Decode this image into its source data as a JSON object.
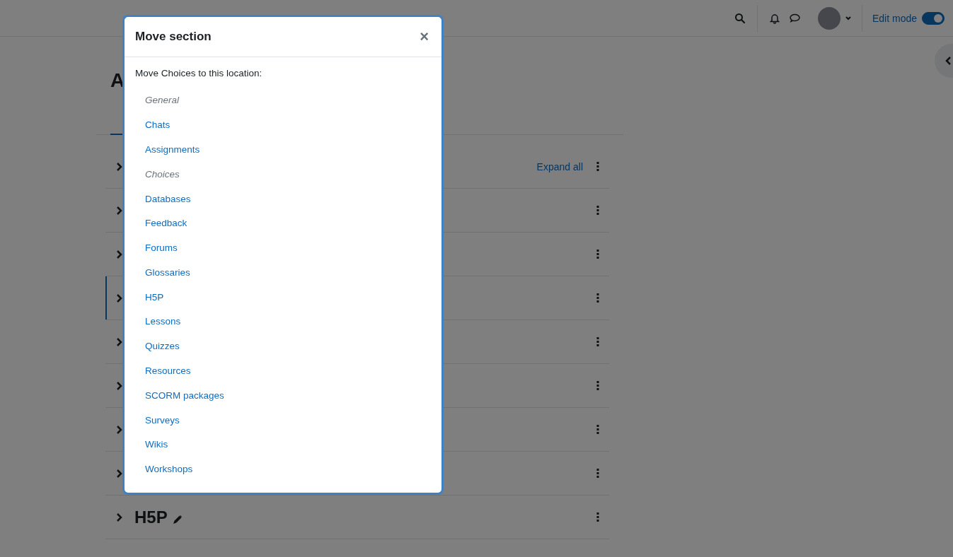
{
  "header": {
    "edit_mode": {
      "label": "Edit mode",
      "on": true
    }
  },
  "page": {
    "title": "A",
    "expand_all": "Expand all",
    "sections": [
      {
        "highlighted": false
      },
      {
        "highlighted": false
      },
      {
        "highlighted": false
      },
      {
        "highlighted": true
      },
      {
        "highlighted": false
      },
      {
        "highlighted": false
      },
      {
        "highlighted": false
      },
      {
        "highlighted": false
      },
      {
        "title": "H5P",
        "highlighted": false
      }
    ]
  },
  "dialog": {
    "title": "Move section",
    "close": "×",
    "prompt": "Move Choices to this location:",
    "locations": [
      {
        "label": "General",
        "disabled": true
      },
      {
        "label": "Chats",
        "disabled": false
      },
      {
        "label": "Assignments",
        "disabled": false
      },
      {
        "label": "Choices",
        "disabled": true
      },
      {
        "label": "Databases",
        "disabled": false
      },
      {
        "label": "Feedback",
        "disabled": false
      },
      {
        "label": "Forums",
        "disabled": false
      },
      {
        "label": "Glossaries",
        "disabled": false
      },
      {
        "label": "H5P",
        "disabled": false
      },
      {
        "label": "Lessons",
        "disabled": false
      },
      {
        "label": "Quizzes",
        "disabled": false
      },
      {
        "label": "Resources",
        "disabled": false
      },
      {
        "label": "SCORM packages",
        "disabled": false
      },
      {
        "label": "Surveys",
        "disabled": false
      },
      {
        "label": "Wikis",
        "disabled": false
      },
      {
        "label": "Workshops",
        "disabled": false
      }
    ]
  }
}
